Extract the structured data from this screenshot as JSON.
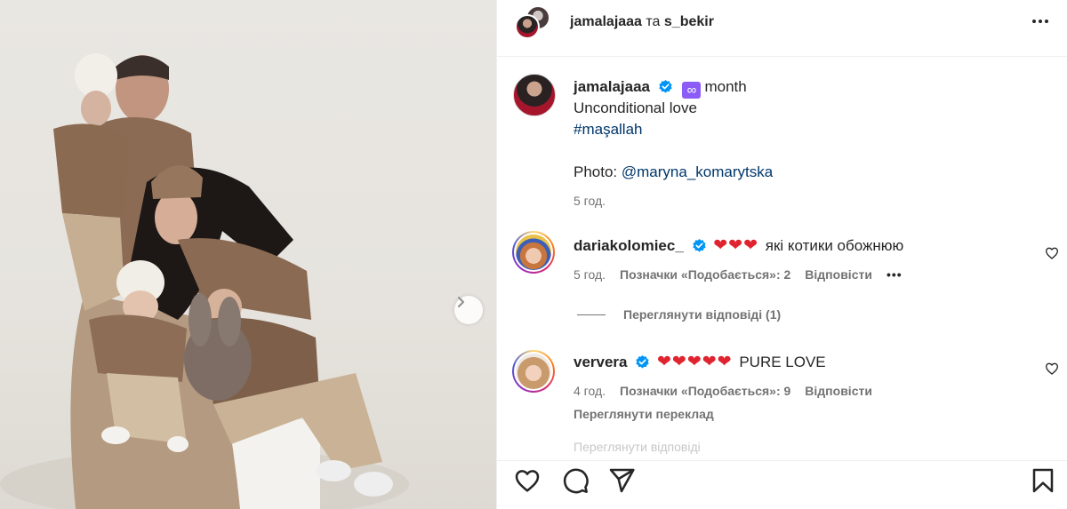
{
  "photo": {
    "next_icon": "chevron-right-icon"
  },
  "header": {
    "user1": "jamalajaaa",
    "connector": "та",
    "user2": "s_bekir",
    "more_icon": "more-horizontal-icon"
  },
  "caption": {
    "username": "jamalajaaa",
    "badge_icon": "infinity",
    "badge_text": "month",
    "line1": "Unconditional love",
    "hashtag": "#maşallah",
    "photo_label": "Photo:",
    "photo_mention": "@maryna_komarytska",
    "time": "5 год."
  },
  "comments": [
    {
      "username": "dariakolomiec_",
      "hearts": "❤❤❤",
      "text": "які котики обожнюю",
      "time": "5 год.",
      "likes": "Позначки «Подобається»: 2",
      "reply": "Відповісти",
      "options": "•••",
      "view_replies": "Переглянути відповіді (1)"
    },
    {
      "username": "ververa",
      "hearts": "❤❤❤❤❤",
      "text": "PURE LOVE",
      "time": "4 год.",
      "likes": "Позначки «Подобається»: 9",
      "reply": "Відповісти",
      "translate": "Переглянути переклад"
    }
  ],
  "faded_text": "Переглянути відповіді",
  "actions": {
    "like_icon": "heart-icon",
    "comment_icon": "comment-icon",
    "share_icon": "send-icon",
    "save_icon": "bookmark-icon"
  },
  "colors": {
    "text": "#262626",
    "secondary": "#737373",
    "link": "#00376b",
    "verified": "#0095f6",
    "heart": "#e0242f",
    "badge": "#8b5cf6"
  }
}
